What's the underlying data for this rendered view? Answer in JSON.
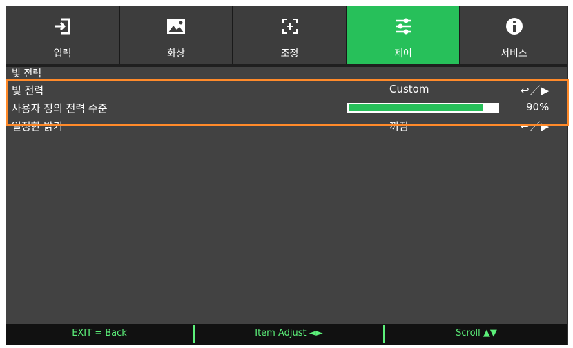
{
  "tabs": [
    {
      "label": "입력",
      "icon": "input-icon"
    },
    {
      "label": "화상",
      "icon": "image-icon"
    },
    {
      "label": "조정",
      "icon": "adjust-icon"
    },
    {
      "label": "제어",
      "icon": "sliders-icon",
      "active": true
    },
    {
      "label": "서비스",
      "icon": "info-icon"
    }
  ],
  "section": {
    "title": "빛 전력"
  },
  "rows": [
    {
      "label": "빛 전력",
      "value": "Custom",
      "nav": "↩／▶"
    },
    {
      "label": "사용자 정의 전력 수준",
      "progress": 0.9,
      "percent": "90%"
    },
    {
      "label": "일정한 밝기",
      "value": "꺼짐",
      "nav": "↩／▶"
    }
  ],
  "footer": {
    "back": "EXIT = Back",
    "adjust": "Item Adjust ◄►",
    "scroll": "Scroll ▲▼"
  },
  "colors": {
    "accent": "#27c05a",
    "highlight": "#ff8a2a",
    "background": "#424242"
  }
}
